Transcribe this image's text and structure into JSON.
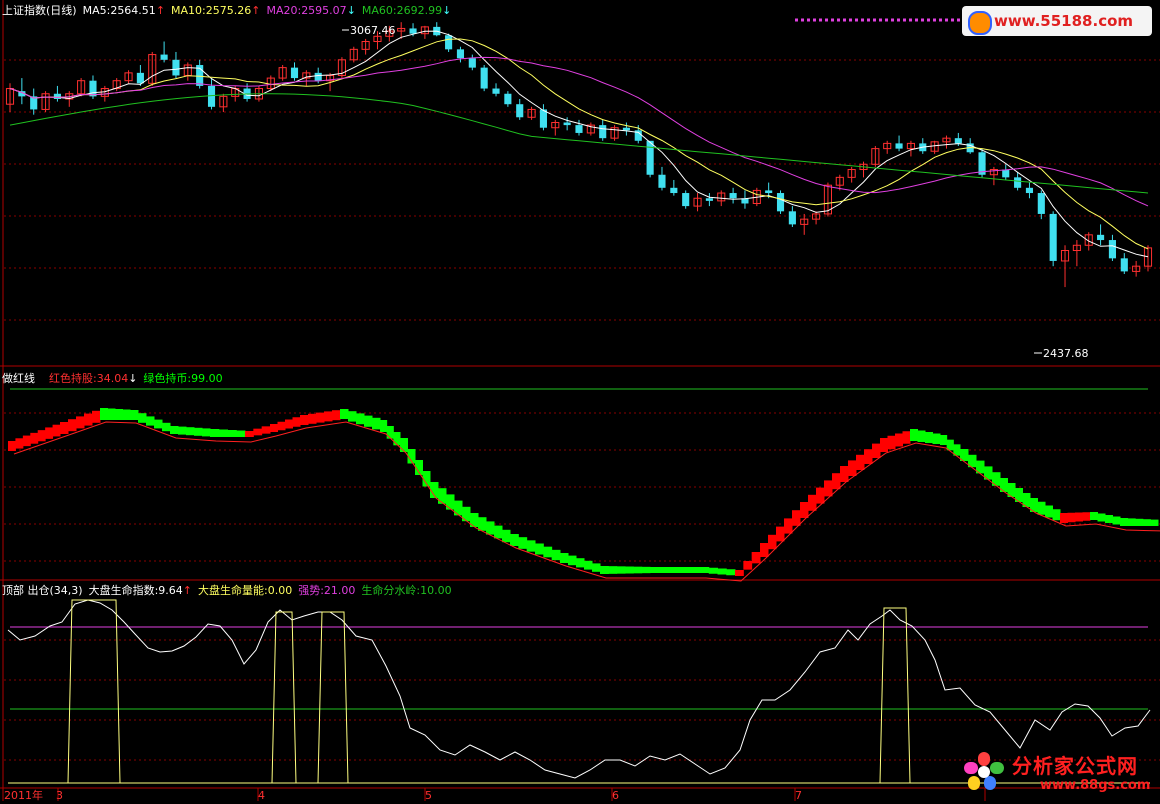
{
  "colors": {
    "bg": "#000000",
    "frame": "#b00000",
    "grid": "#8a0000",
    "up_candle": "#ff3030",
    "down_candle": "#40e0f0",
    "ma5": "#ffffff",
    "ma10": "#ffff60",
    "ma20": "#e040e0",
    "ma60": "#20c020",
    "red_band": "#ff0000",
    "green_band": "#00ff00",
    "life_line": "#ffffff",
    "signal_line": "#ffff80",
    "strong_line": "#e040e0",
    "divide_line": "#20c020"
  },
  "panel1": {
    "title": "上证指数(日线)",
    "ma5_label": "MA5:2564.51",
    "ma10_label": "MA10:2575.26",
    "ma20_label": "MA20:2595.07",
    "ma60_label": "MA60:2692.99",
    "ma5_arrow": "↑",
    "ma10_arrow": "↑",
    "ma20_arrow": "↓",
    "ma60_arrow": "↓",
    "high_label": "3067.46",
    "low_label": "2437.68"
  },
  "panel2": {
    "title": "做红线",
    "red_label": "红色持股:34.04",
    "red_arrow": "↓",
    "green_label": "绿色持币:99.00"
  },
  "panel3": {
    "title": "顶部 出仓(34,3)",
    "index_label": "大盘生命指数:9.64",
    "index_arrow": "↑",
    "energy_label": "大盘生命量能:0.00",
    "strong_label": "强势:21.00",
    "divide_label": "生命分水岭:10.00"
  },
  "xaxis": {
    "labels": [
      "2011年",
      "3",
      "4",
      "5",
      "6",
      "7"
    ]
  },
  "watermark": {
    "top": "www.55188.com",
    "bottom_text": "分析家公式网",
    "bottom_url": "www.88gs.com"
  },
  "chart_data": [
    {
      "type": "candlestick",
      "title": "上证指数(日线)",
      "x": [
        "2011-03",
        "2011-04",
        "2011-05",
        "2011-06",
        "2011-07"
      ],
      "price_high": 3067.46,
      "price_low": 2437.68,
      "ohlc_approx": [
        [
          2910,
          2950,
          2895,
          2940
        ],
        [
          2935,
          2960,
          2910,
          2925
        ],
        [
          2925,
          2940,
          2890,
          2900
        ],
        [
          2900,
          2935,
          2895,
          2930
        ],
        [
          2930,
          2945,
          2915,
          2920
        ],
        [
          2920,
          2935,
          2905,
          2930
        ],
        [
          2930,
          2960,
          2925,
          2955
        ],
        [
          2955,
          2965,
          2920,
          2925
        ],
        [
          2925,
          2945,
          2915,
          2940
        ],
        [
          2940,
          2960,
          2935,
          2955
        ],
        [
          2955,
          2975,
          2950,
          2970
        ],
        [
          2970,
          2985,
          2945,
          2950
        ],
        [
          2950,
          3010,
          2945,
          3005
        ],
        [
          3005,
          3030,
          2990,
          2995
        ],
        [
          2995,
          3010,
          2960,
          2965
        ],
        [
          2965,
          2990,
          2955,
          2985
        ],
        [
          2985,
          2995,
          2940,
          2945
        ],
        [
          2945,
          2960,
          2900,
          2905
        ],
        [
          2905,
          2930,
          2895,
          2925
        ],
        [
          2925,
          2945,
          2915,
          2940
        ],
        [
          2940,
          2950,
          2915,
          2920
        ],
        [
          2920,
          2945,
          2915,
          2940
        ],
        [
          2940,
          2965,
          2935,
          2960
        ],
        [
          2960,
          2985,
          2955,
          2980
        ],
        [
          2980,
          2990,
          2955,
          2960
        ],
        [
          2960,
          2975,
          2945,
          2970
        ],
        [
          2970,
          2980,
          2950,
          2955
        ],
        [
          2955,
          2970,
          2935,
          2965
        ],
        [
          2965,
          3000,
          2960,
          2995
        ],
        [
          2995,
          3020,
          2990,
          3015
        ],
        [
          3015,
          3035,
          3005,
          3030
        ],
        [
          3030,
          3050,
          3015,
          3040
        ],
        [
          3040,
          3060,
          3030,
          3050
        ],
        [
          3050,
          3067,
          3035,
          3055
        ],
        [
          3055,
          3065,
          3040,
          3045
        ],
        [
          3045,
          3060,
          3035,
          3058
        ],
        [
          3058,
          3067,
          3040,
          3042
        ],
        [
          3042,
          3045,
          3010,
          3015
        ],
        [
          3015,
          3020,
          2990,
          2998
        ],
        [
          2998,
          3005,
          2975,
          2980
        ],
        [
          2980,
          2985,
          2935,
          2940
        ],
        [
          2940,
          2950,
          2925,
          2930
        ],
        [
          2930,
          2935,
          2905,
          2910
        ],
        [
          2910,
          2920,
          2880,
          2885
        ],
        [
          2885,
          2905,
          2880,
          2900
        ],
        [
          2900,
          2910,
          2860,
          2865
        ],
        [
          2865,
          2880,
          2850,
          2875
        ],
        [
          2875,
          2885,
          2860,
          2870
        ],
        [
          2870,
          2880,
          2850,
          2855
        ],
        [
          2855,
          2875,
          2850,
          2870
        ],
        [
          2870,
          2880,
          2840,
          2845
        ],
        [
          2845,
          2870,
          2840,
          2865
        ],
        [
          2865,
          2875,
          2850,
          2860
        ],
        [
          2860,
          2870,
          2835,
          2840
        ],
        [
          2840,
          2820,
          2770,
          2775
        ],
        [
          2775,
          2790,
          2745,
          2750
        ],
        [
          2750,
          2765,
          2735,
          2740
        ],
        [
          2740,
          2745,
          2710,
          2715
        ],
        [
          2715,
          2740,
          2705,
          2730
        ],
        [
          2730,
          2740,
          2715,
          2725
        ],
        [
          2725,
          2745,
          2715,
          2740
        ],
        [
          2740,
          2750,
          2720,
          2730
        ],
        [
          2730,
          2745,
          2710,
          2720
        ],
        [
          2720,
          2750,
          2715,
          2745
        ],
        [
          2745,
          2760,
          2730,
          2740
        ],
        [
          2740,
          2745,
          2700,
          2705
        ],
        [
          2705,
          2715,
          2675,
          2680
        ],
        [
          2680,
          2700,
          2660,
          2690
        ],
        [
          2690,
          2705,
          2680,
          2700
        ],
        [
          2700,
          2760,
          2695,
          2755
        ],
        [
          2755,
          2775,
          2745,
          2770
        ],
        [
          2770,
          2790,
          2760,
          2785
        ],
        [
          2785,
          2800,
          2770,
          2795
        ],
        [
          2795,
          2830,
          2790,
          2825
        ],
        [
          2825,
          2840,
          2815,
          2835
        ],
        [
          2835,
          2850,
          2820,
          2825
        ],
        [
          2825,
          2840,
          2810,
          2835
        ],
        [
          2835,
          2845,
          2815,
          2820
        ],
        [
          2820,
          2840,
          2815,
          2838
        ],
        [
          2838,
          2850,
          2825,
          2845
        ],
        [
          2845,
          2855,
          2830,
          2835
        ],
        [
          2835,
          2845,
          2815,
          2818
        ],
        [
          2818,
          2825,
          2770,
          2775
        ],
        [
          2775,
          2790,
          2755,
          2785
        ],
        [
          2785,
          2795,
          2765,
          2770
        ],
        [
          2770,
          2780,
          2745,
          2750
        ],
        [
          2750,
          2760,
          2730,
          2740
        ],
        [
          2740,
          2745,
          2690,
          2700
        ],
        [
          2700,
          2705,
          2600,
          2610
        ],
        [
          2610,
          2640,
          2560,
          2630
        ],
        [
          2630,
          2650,
          2600,
          2640
        ],
        [
          2640,
          2665,
          2630,
          2660
        ],
        [
          2660,
          2680,
          2640,
          2650
        ],
        [
          2650,
          2660,
          2610,
          2615
        ],
        [
          2615,
          2625,
          2585,
          2590
        ],
        [
          2590,
          2610,
          2580,
          2600
        ],
        [
          2600,
          2640,
          2590,
          2635
        ]
      ]
    },
    {
      "type": "line",
      "title": "做红线",
      "series": [
        {
          "name": "红色持股",
          "last": 34.04
        },
        {
          "name": "绿色持币",
          "last": 99.0
        }
      ]
    },
    {
      "type": "line",
      "title": "顶部 出仓(34,3)",
      "series": [
        {
          "name": "大盘生命指数",
          "last": 9.64
        },
        {
          "name": "大盘生命量能",
          "last": 0.0
        },
        {
          "name": "强势",
          "last": 21.0
        },
        {
          "name": "生命分水岭",
          "last": 10.0
        }
      ]
    }
  ]
}
